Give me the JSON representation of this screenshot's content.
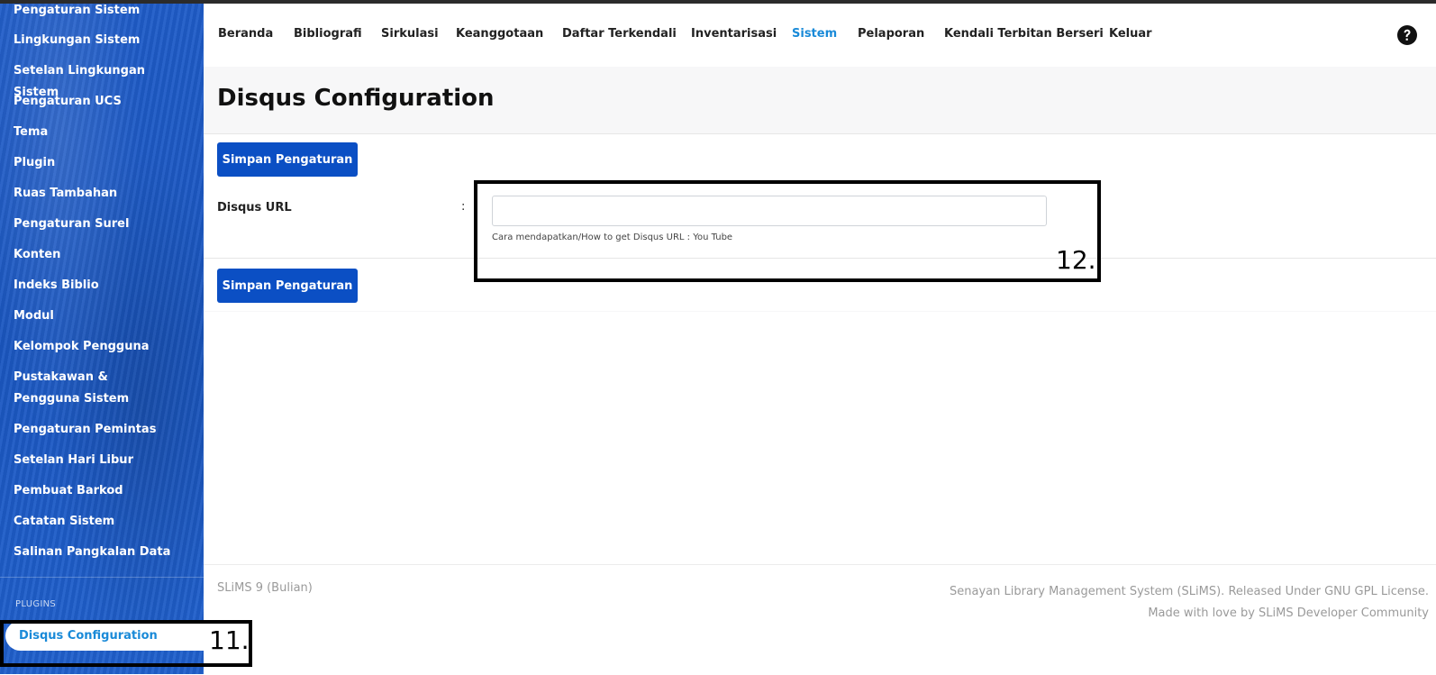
{
  "sidebar": {
    "items": [
      "Pengaturan Sistem",
      "Lingkungan Sistem",
      "Setelan Lingkungan Sistem",
      "Pengaturan UCS",
      "Tema",
      "Plugin",
      "Ruas Tambahan",
      "Pengaturan Surel",
      "Konten",
      "Indeks Biblio",
      "Modul",
      "Kelompok Pengguna",
      "Pustakawan & Pengguna Sistem",
      "Pengaturan Pemintas",
      "Setelan Hari Libur",
      "Pembuat Barkod",
      "Catatan Sistem",
      "Salinan Pangkalan Data"
    ],
    "section_label": "PLUGINS",
    "active_item": "Disqus Configuration"
  },
  "nav": {
    "items": [
      "Beranda",
      "Bibliografi",
      "Sirkulasi",
      "Keanggotaan",
      "Daftar Terkendali",
      "Inventarisasi",
      "Sistem",
      "Pelaporan",
      "Kendali Terbitan Berseri",
      "Keluar"
    ],
    "active": "Sistem",
    "help_icon": "question-circle-icon"
  },
  "main": {
    "title": "Disqus Configuration",
    "save_label": "Simpan Pengaturan",
    "field_label": "Disqus URL",
    "field_colon": ":",
    "field_value": "",
    "field_help": "Cara mendapatkan/How to get Disqus URL : You Tube"
  },
  "footer": {
    "left": "SLiMS 9 (Bulian)",
    "right_line1": "Senayan Library Management System (SLiMS). Released Under GNU GPL License.",
    "right_line2": "Made with love by SLiMS Developer Community"
  },
  "annotations": {
    "label_11": "11.",
    "label_12": "12."
  },
  "colors": {
    "sidebar_blue": "#1a56c0",
    "button_blue": "#0b4fc4",
    "active_link": "#1a8ad8"
  }
}
